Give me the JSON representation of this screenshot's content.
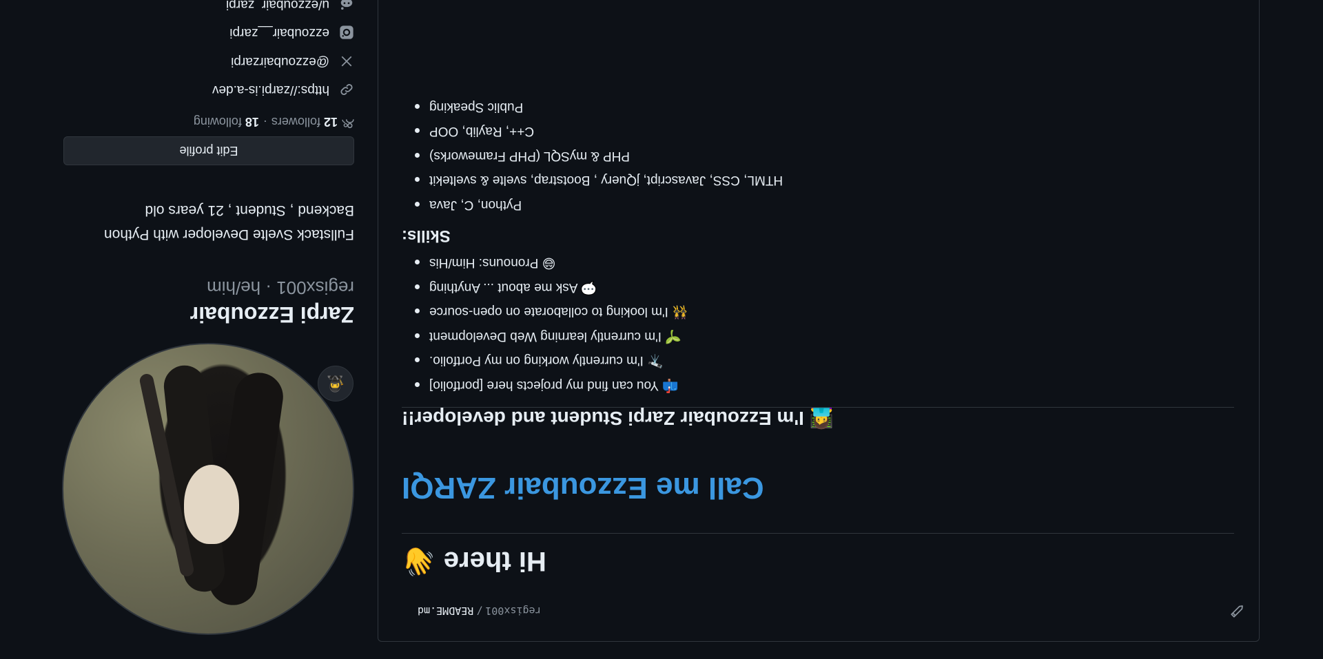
{
  "profile": {
    "display_name": "Zarpi Ezzoubair",
    "username": "regisx001",
    "pronouns": "he/him",
    "separator": "·",
    "bio_line1": "Fullstack Svelte Developer with Python",
    "bio_line2": "Backend , Student , 21 years old",
    "edit_profile_label": "Edit profile",
    "status_emoji": "🥷",
    "followers_count": "12",
    "followers_label": "followers",
    "following_count": "18",
    "following_label": "following",
    "dot": "·"
  },
  "links": {
    "website": "https://zarpi.is-a.dev",
    "twitter": "@ezzoubairzarpi",
    "instagram": "ezzoubair__zarpi",
    "reddit": "u/ezzoubair_zarpi"
  },
  "readme": {
    "repo": "regisx001",
    "slash": "/",
    "file": "README.md",
    "greeting": "Hi there 👋",
    "call_me": "Call me Ezzoubair ZARQI",
    "intro": "👩‍💻 I'm Ezzoubair Zarpi Student and developer!!",
    "intro_items": [
      "📫 You can find my projects here [portfolio]",
      "🔭 I'm currently working on my Portfolio.",
      "🌱 I'm currently learning Web Development",
      "👯 I'm looking to collaborate on open-source",
      "💬 Ask me about ... Anything",
      "😄 Pronouns: Him/His"
    ],
    "skills_heading": "Skills:",
    "skills_items": [
      "Python, C, Java",
      "HTML, CSS, Javascript, jQuery , Bootstrap, svelte & sveltekit",
      "PHP & mySQL (PHP Frameworks)",
      "C++, Raylib, OOP",
      "Public Speaking"
    ]
  },
  "icons": {
    "link": "link-icon",
    "twitter": "x-twitter-icon",
    "instagram": "instagram-icon",
    "reddit": "reddit-icon",
    "people": "people-icon",
    "pencil": "pencil-icon"
  },
  "colors": {
    "background": "#0d1117",
    "text": "#e6edf3",
    "muted": "#8b949e",
    "border": "#30363d",
    "accent_blue": "#3b97e0"
  }
}
